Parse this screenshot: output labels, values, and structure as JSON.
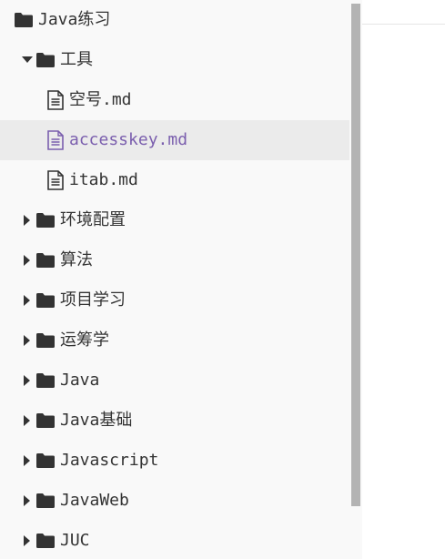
{
  "sidebar": {
    "root": {
      "label": "Java练习",
      "icon": "folder-icon"
    },
    "items": [
      {
        "label": "工具",
        "type": "folder",
        "expanded": true,
        "depth": 1,
        "icon": "folder-icon"
      },
      {
        "label": "空号.md",
        "type": "file",
        "depth": 2,
        "icon": "file-icon"
      },
      {
        "label": "accesskey.md",
        "type": "file",
        "depth": 2,
        "icon": "file-icon",
        "active": true
      },
      {
        "label": "itab.md",
        "type": "file",
        "depth": 2,
        "icon": "file-icon"
      },
      {
        "label": "环境配置",
        "type": "folder",
        "expanded": false,
        "depth": 1,
        "icon": "folder-icon"
      },
      {
        "label": "算法",
        "type": "folder",
        "expanded": false,
        "depth": 1,
        "icon": "folder-icon"
      },
      {
        "label": "项目学习",
        "type": "folder",
        "expanded": false,
        "depth": 1,
        "icon": "folder-icon"
      },
      {
        "label": "运筹学",
        "type": "folder",
        "expanded": false,
        "depth": 1,
        "icon": "folder-icon"
      },
      {
        "label": "Java",
        "type": "folder",
        "expanded": false,
        "depth": 1,
        "icon": "folder-icon"
      },
      {
        "label": "Java基础",
        "type": "folder",
        "expanded": false,
        "depth": 1,
        "icon": "folder-icon"
      },
      {
        "label": "Javascript",
        "type": "folder",
        "expanded": false,
        "depth": 1,
        "icon": "folder-icon"
      },
      {
        "label": "JavaWeb",
        "type": "folder",
        "expanded": false,
        "depth": 1,
        "icon": "folder-icon"
      },
      {
        "label": "JUC",
        "type": "folder",
        "expanded": false,
        "depth": 1,
        "icon": "folder-icon"
      }
    ]
  },
  "colors": {
    "sidebar_bg": "#f9f9f9",
    "active_row_bg": "#ebebeb",
    "active_text": "#7b5fae",
    "text": "#333333",
    "icon": "#333333",
    "scrollbar_thumb": "#b3b3b3"
  }
}
